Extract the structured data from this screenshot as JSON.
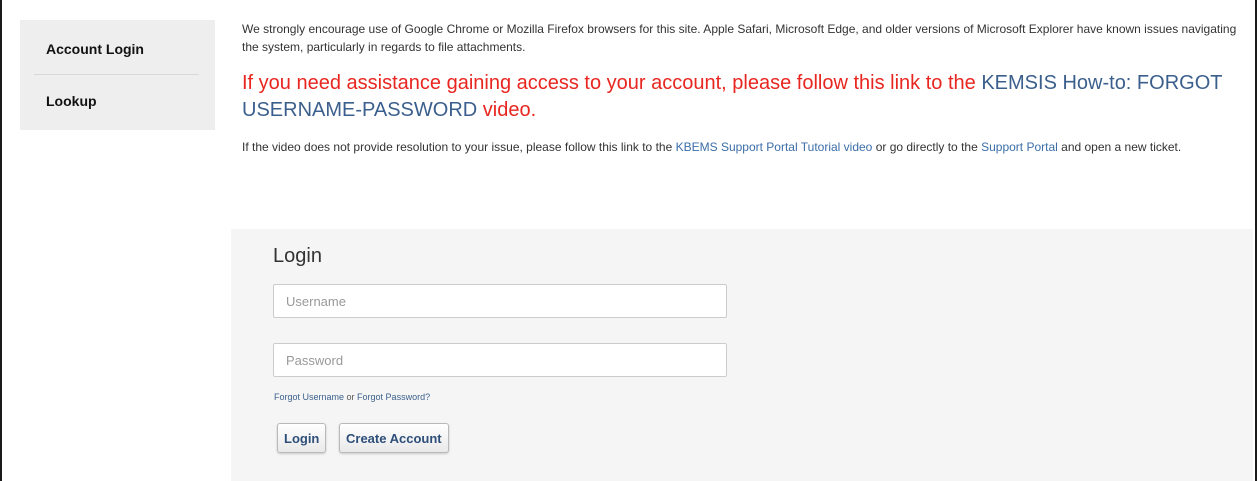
{
  "sidebar": {
    "items": [
      {
        "label": "Account Login"
      },
      {
        "label": "Lookup"
      }
    ]
  },
  "notice": {
    "text": "We strongly encourage use of Google Chrome or Mozilla Firefox browsers for this site. Apple Safari, Microsoft Edge, and older versions of Microsoft Explorer have known issues navigating the system, particularly in regards to file attachments."
  },
  "assist": {
    "prefix": "If you need assistance gaining access to your account, please follow this link to the ",
    "link": "KEMSIS How-to: FORGOT USERNAME-PASSWORD",
    "suffix": " video."
  },
  "followup": {
    "prefix": "If the video does not provide resolution to your issue, please follow this link to the ",
    "tutorial_link": "KBEMS Support Portal Tutorial video",
    "middle": " or go directly to the ",
    "portal_link": "Support Portal",
    "suffix": " and open a new ticket."
  },
  "login": {
    "title": "Login",
    "username_placeholder": "Username",
    "password_placeholder": "Password",
    "forgot_username": "Forgot Username",
    "or": " or ",
    "forgot_password": "Forgot Password?",
    "login_button": "Login",
    "create_button": "Create Account"
  },
  "colors": {
    "alert_red": "#e8261f",
    "link_blue": "#3b5f8d",
    "sidebar_bg": "#eeeeee",
    "panel_bg": "#f5f5f5"
  }
}
